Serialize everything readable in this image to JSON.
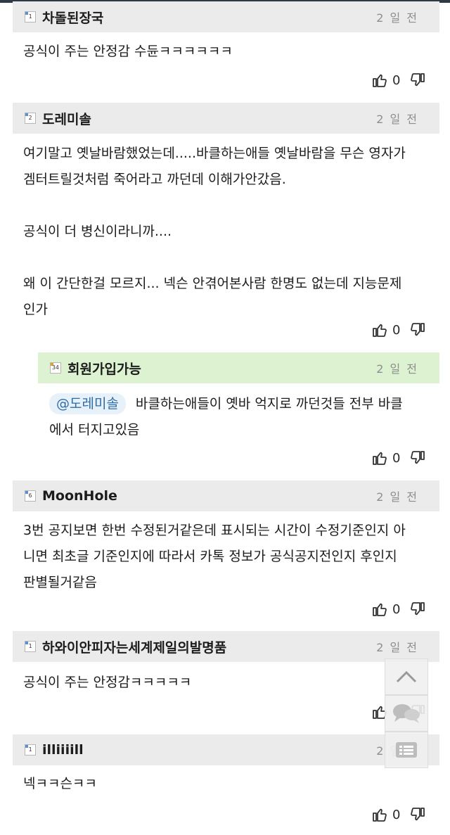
{
  "comments": [
    {
      "level": "1",
      "nickname": "차돌된장국",
      "time": "2 일 전",
      "body": "공식이 주는 안정감 수듄ㅋㅋㅋㅋㅋㅋ",
      "likes": "0"
    },
    {
      "level": "2",
      "nickname": "도레미솔",
      "time": "2 일 전",
      "body": "여기말고 옛날바람했었는데.....바클하는애들 옛날바람을 무슨 영자가\n겜터트릴것처럼 죽어라고 까던데 이해가안갔음.\n\n공식이 더 병신이라니까....\n\n왜 이 간단한걸 모르지... 넥슨 안겪어본사람 한명도 없는데 지능문제\n인가",
      "likes": "0"
    },
    {
      "level": "34",
      "nickname": "회원가입가능",
      "time": "2 일 전",
      "mention": "@도레미솔",
      "body": "바클하는애들이 옛바 억지로 까던것들 전부 바클\n에서 터지고있음",
      "likes": "0"
    },
    {
      "level": "6",
      "nickname": "MoonHole",
      "time": "2 일 전",
      "body": "3번 공지보면 한번 수정된거같은데 표시되는 시간이 수정기준인지 아\n니면 최초글 기준인지에 따라서 카톡 정보가 공식공지전인지 후인지\n판별될거같음",
      "likes": "0"
    },
    {
      "level": "1",
      "nickname": "하와이안피자는세계제일의발명품",
      "time": "2 일 전",
      "body": "공식이 주는 안정감ㅋㅋㅋㅋㅋ",
      "likes": "0"
    },
    {
      "level": "1",
      "nickname": "illiiiill",
      "time": "2 일 전",
      "body": "넥ㅋㅋ슨ㅋㅋ",
      "likes": "0"
    }
  ],
  "icons": {
    "like": "thumbs-up-icon",
    "dislike": "thumbs-down-icon",
    "scroll_top": "chevron-up-icon",
    "comments": "chat-bubbles-icon",
    "list": "list-icon"
  },
  "colors": {
    "header_bg": "#ebebeb",
    "reply_header_bg": "#dcf2d1",
    "mention_color": "#2e6ca8"
  }
}
